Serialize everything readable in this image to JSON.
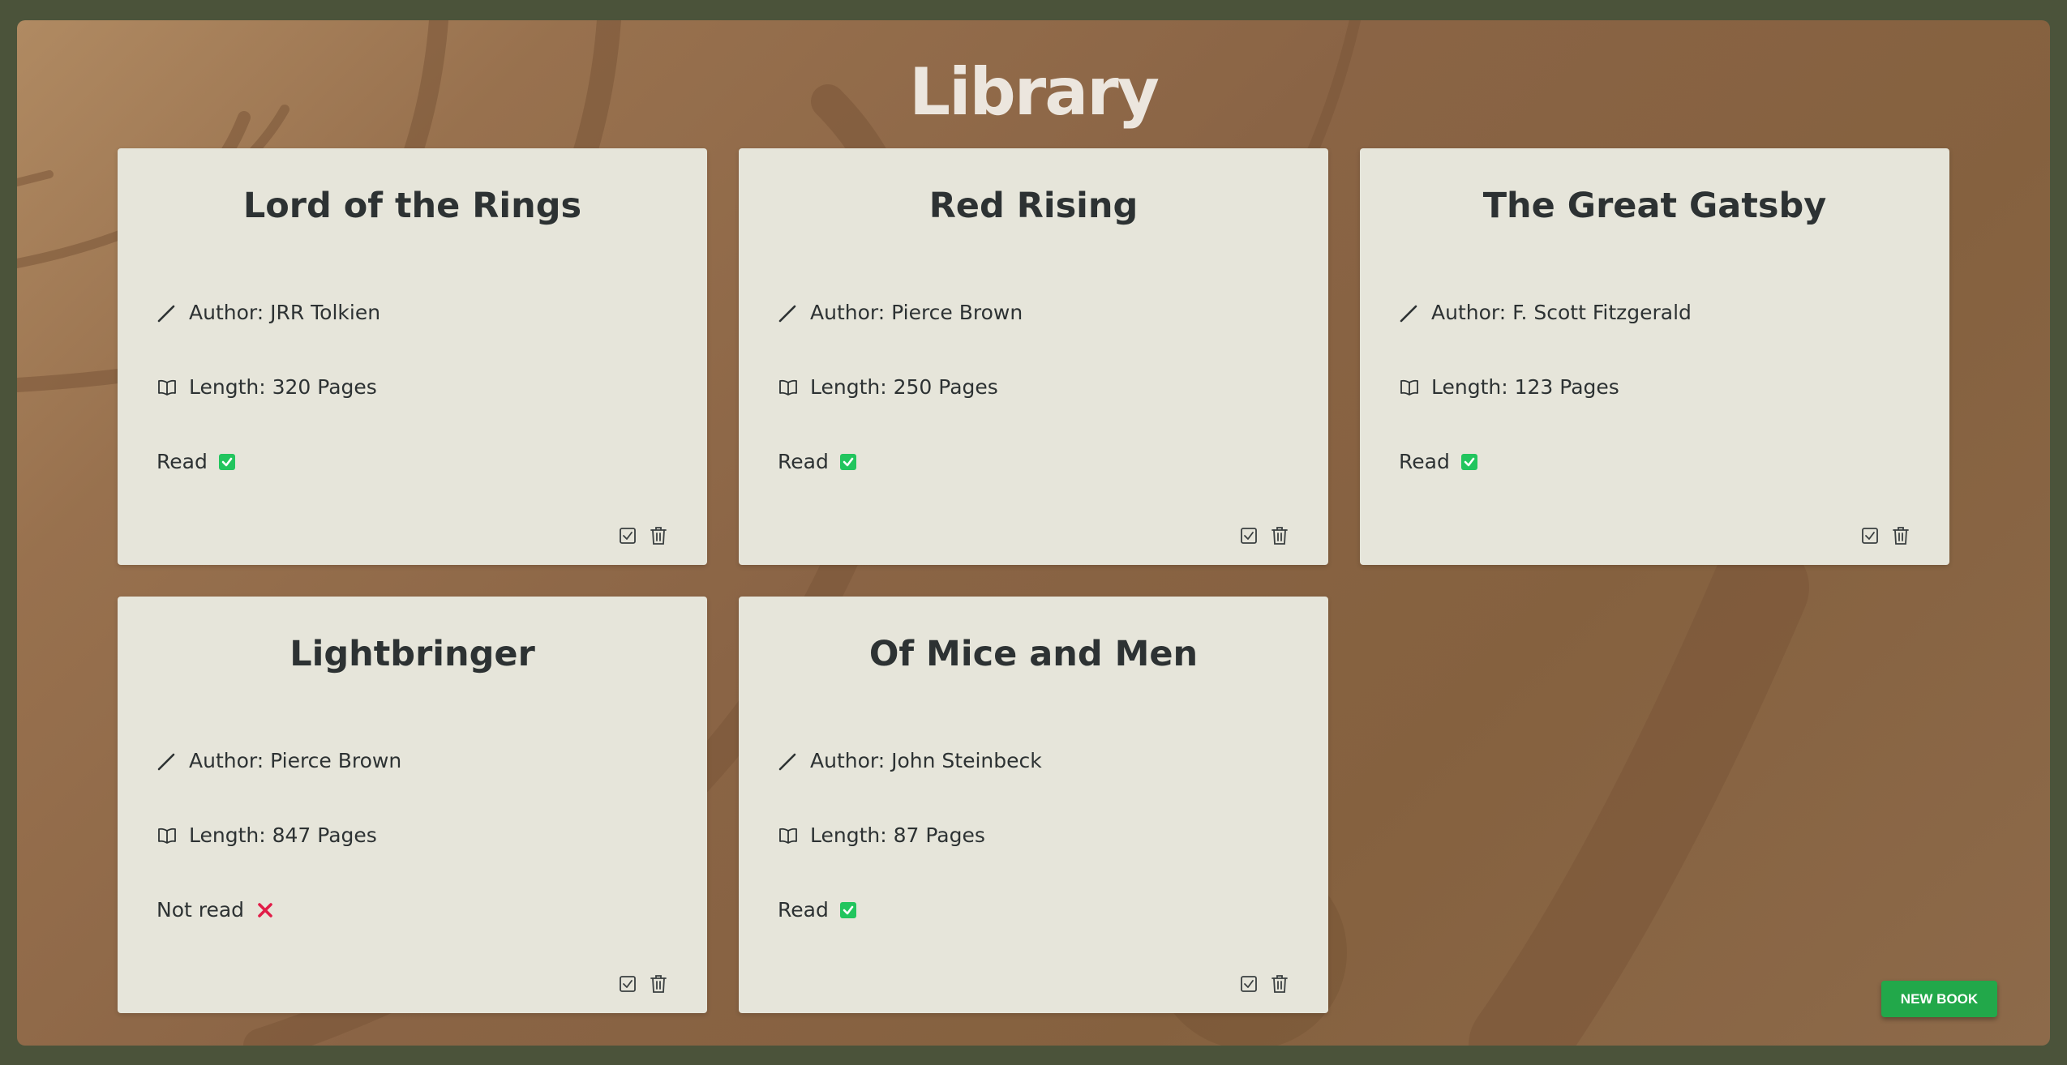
{
  "page": {
    "title": "Library"
  },
  "books": [
    {
      "title": "Lord of the Rings",
      "author": "Author: JRR Tolkien",
      "length": "Length: 320 Pages",
      "status": "Read",
      "read": true
    },
    {
      "title": "Red Rising",
      "author": "Author: Pierce Brown",
      "length": "Length: 250 Pages",
      "status": "Read",
      "read": true
    },
    {
      "title": "The Great Gatsby",
      "author": "Author: F. Scott Fitzgerald",
      "length": "Length: 123 Pages",
      "status": "Read",
      "read": true
    },
    {
      "title": "Lightbringer",
      "author": "Author: Pierce Brown",
      "length": "Length: 847 Pages",
      "status": "Not read",
      "read": false
    },
    {
      "title": "Of Mice and Men",
      "author": "Author: John Steinbeck",
      "length": "Length: 87 Pages",
      "status": "Read",
      "read": true
    }
  ],
  "new_book_label": "NEW BOOK",
  "icons": {
    "author": "pencil-icon",
    "length": "open-book-icon",
    "read": "checkbox-checked-icon",
    "not_read": "cross-icon",
    "toggle": "check-square-icon",
    "delete": "trash-icon"
  },
  "colors": {
    "read": "#22c55e",
    "not_read": "#e11d48",
    "accent_button": "#22a84a",
    "card": "#e6e5da",
    "frame": "#4b533a"
  }
}
